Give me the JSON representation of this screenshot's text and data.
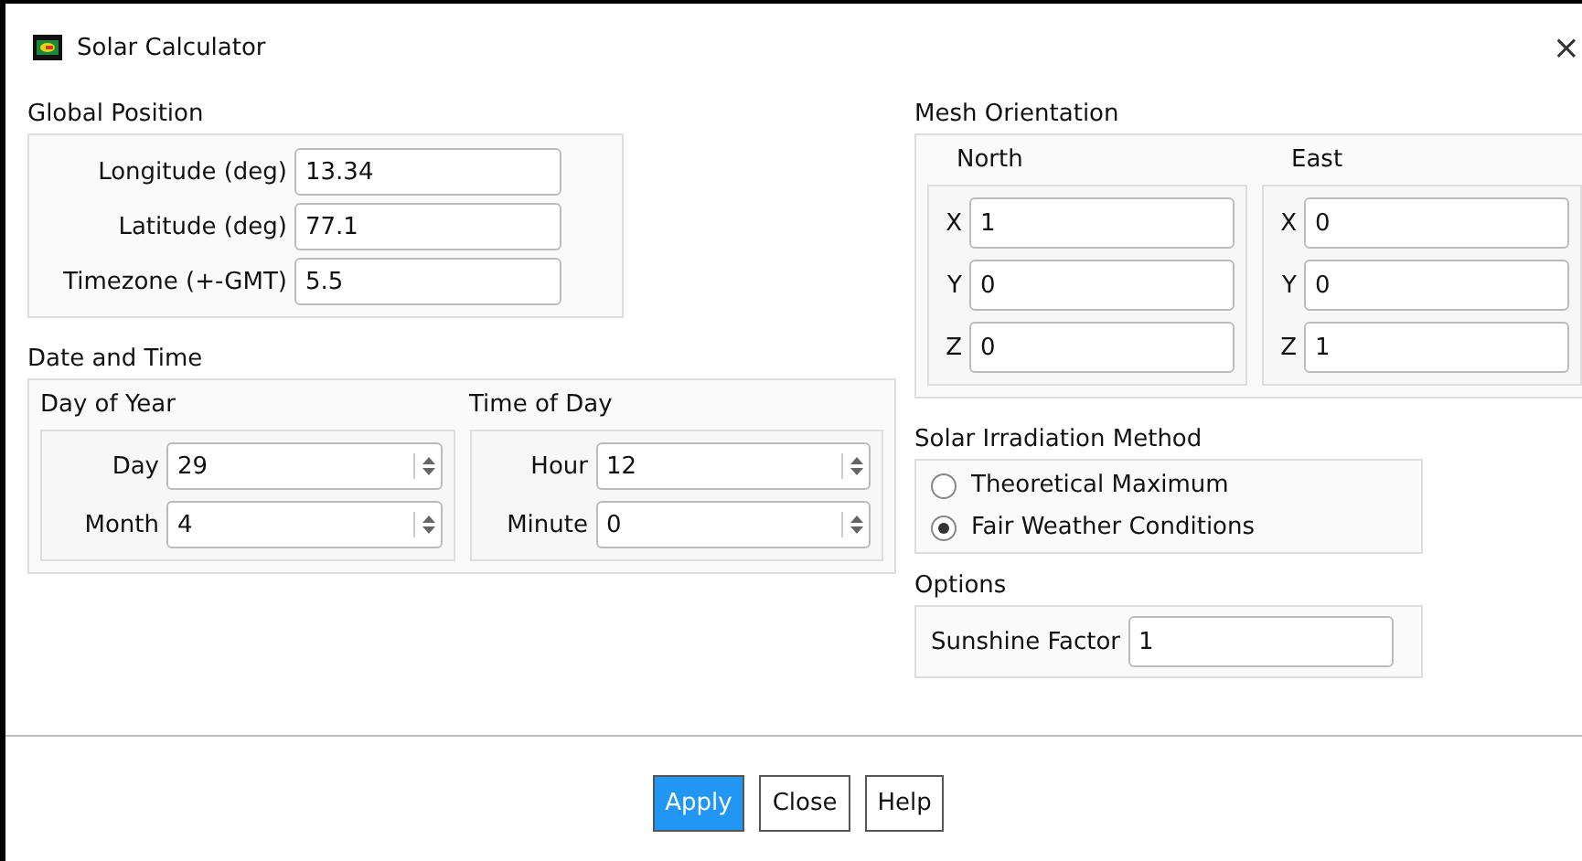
{
  "window": {
    "title": "Solar Calculator",
    "close": "×"
  },
  "global_position": {
    "title": "Global Position",
    "fields": [
      {
        "label": "Longitude (deg)",
        "value": "13.34"
      },
      {
        "label": "Latitude (deg)",
        "value": "77.1"
      },
      {
        "label": "Timezone (+-GMT)",
        "value": "5.5"
      }
    ]
  },
  "mesh_orientation": {
    "title": "Mesh Orientation",
    "groups": [
      {
        "title": "North",
        "fields": [
          {
            "label": "X",
            "value": "1"
          },
          {
            "label": "Y",
            "value": "0"
          },
          {
            "label": "Z",
            "value": "0"
          }
        ]
      },
      {
        "title": "East",
        "fields": [
          {
            "label": "X",
            "value": "0"
          },
          {
            "label": "Y",
            "value": "0"
          },
          {
            "label": "Z",
            "value": "1"
          }
        ]
      }
    ]
  },
  "date_and_time": {
    "title": "Date and Time",
    "groups": [
      {
        "title": "Day of Year",
        "fields": [
          {
            "label": "Day",
            "value": "29"
          },
          {
            "label": "Month",
            "value": "4"
          }
        ]
      },
      {
        "title": "Time of Day",
        "fields": [
          {
            "label": "Hour",
            "value": "12"
          },
          {
            "label": "Minute",
            "value": "0"
          }
        ]
      }
    ]
  },
  "solar_irradiation_method": {
    "title": "Solar Irradiation Method",
    "options": [
      {
        "label": "Theoretical Maximum",
        "selected": false
      },
      {
        "label": "Fair Weather Conditions",
        "selected": true
      }
    ]
  },
  "options": {
    "title": "Options",
    "fields": [
      {
        "label": "Sunshine Factor",
        "value": "1"
      }
    ]
  },
  "buttons": [
    {
      "label": "Apply",
      "primary": true
    },
    {
      "label": "Close",
      "primary": false
    },
    {
      "label": "Help",
      "primary": false
    }
  ]
}
